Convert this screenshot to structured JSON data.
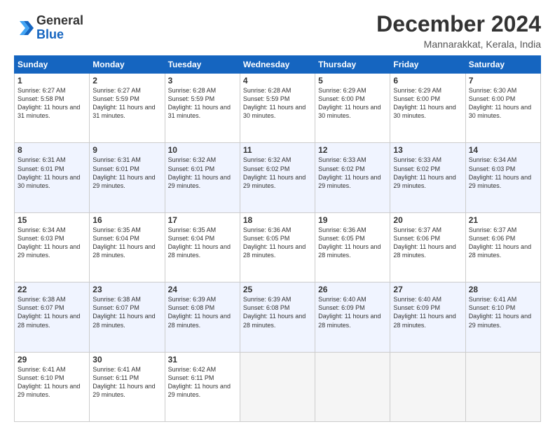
{
  "header": {
    "logo_line1": "General",
    "logo_line2": "Blue",
    "month": "December 2024",
    "location": "Mannarakkat, Kerala, India"
  },
  "days_of_week": [
    "Sunday",
    "Monday",
    "Tuesday",
    "Wednesday",
    "Thursday",
    "Friday",
    "Saturday"
  ],
  "weeks": [
    {
      "days": [
        {
          "num": "1",
          "rise": "6:27 AM",
          "set": "5:58 PM",
          "daylight": "11 hours and 31 minutes."
        },
        {
          "num": "2",
          "rise": "6:27 AM",
          "set": "5:59 PM",
          "daylight": "11 hours and 31 minutes."
        },
        {
          "num": "3",
          "rise": "6:28 AM",
          "set": "5:59 PM",
          "daylight": "11 hours and 31 minutes."
        },
        {
          "num": "4",
          "rise": "6:28 AM",
          "set": "5:59 PM",
          "daylight": "11 hours and 30 minutes."
        },
        {
          "num": "5",
          "rise": "6:29 AM",
          "set": "6:00 PM",
          "daylight": "11 hours and 30 minutes."
        },
        {
          "num": "6",
          "rise": "6:29 AM",
          "set": "6:00 PM",
          "daylight": "11 hours and 30 minutes."
        },
        {
          "num": "7",
          "rise": "6:30 AM",
          "set": "6:00 PM",
          "daylight": "11 hours and 30 minutes."
        }
      ]
    },
    {
      "days": [
        {
          "num": "8",
          "rise": "6:31 AM",
          "set": "6:01 PM",
          "daylight": "11 hours and 30 minutes."
        },
        {
          "num": "9",
          "rise": "6:31 AM",
          "set": "6:01 PM",
          "daylight": "11 hours and 29 minutes."
        },
        {
          "num": "10",
          "rise": "6:32 AM",
          "set": "6:01 PM",
          "daylight": "11 hours and 29 minutes."
        },
        {
          "num": "11",
          "rise": "6:32 AM",
          "set": "6:02 PM",
          "daylight": "11 hours and 29 minutes."
        },
        {
          "num": "12",
          "rise": "6:33 AM",
          "set": "6:02 PM",
          "daylight": "11 hours and 29 minutes."
        },
        {
          "num": "13",
          "rise": "6:33 AM",
          "set": "6:02 PM",
          "daylight": "11 hours and 29 minutes."
        },
        {
          "num": "14",
          "rise": "6:34 AM",
          "set": "6:03 PM",
          "daylight": "11 hours and 29 minutes."
        }
      ]
    },
    {
      "days": [
        {
          "num": "15",
          "rise": "6:34 AM",
          "set": "6:03 PM",
          "daylight": "11 hours and 29 minutes."
        },
        {
          "num": "16",
          "rise": "6:35 AM",
          "set": "6:04 PM",
          "daylight": "11 hours and 28 minutes."
        },
        {
          "num": "17",
          "rise": "6:35 AM",
          "set": "6:04 PM",
          "daylight": "11 hours and 28 minutes."
        },
        {
          "num": "18",
          "rise": "6:36 AM",
          "set": "6:05 PM",
          "daylight": "11 hours and 28 minutes."
        },
        {
          "num": "19",
          "rise": "6:36 AM",
          "set": "6:05 PM",
          "daylight": "11 hours and 28 minutes."
        },
        {
          "num": "20",
          "rise": "6:37 AM",
          "set": "6:06 PM",
          "daylight": "11 hours and 28 minutes."
        },
        {
          "num": "21",
          "rise": "6:37 AM",
          "set": "6:06 PM",
          "daylight": "11 hours and 28 minutes."
        }
      ]
    },
    {
      "days": [
        {
          "num": "22",
          "rise": "6:38 AM",
          "set": "6:07 PM",
          "daylight": "11 hours and 28 minutes."
        },
        {
          "num": "23",
          "rise": "6:38 AM",
          "set": "6:07 PM",
          "daylight": "11 hours and 28 minutes."
        },
        {
          "num": "24",
          "rise": "6:39 AM",
          "set": "6:08 PM",
          "daylight": "11 hours and 28 minutes."
        },
        {
          "num": "25",
          "rise": "6:39 AM",
          "set": "6:08 PM",
          "daylight": "11 hours and 28 minutes."
        },
        {
          "num": "26",
          "rise": "6:40 AM",
          "set": "6:09 PM",
          "daylight": "11 hours and 28 minutes."
        },
        {
          "num": "27",
          "rise": "6:40 AM",
          "set": "6:09 PM",
          "daylight": "11 hours and 28 minutes."
        },
        {
          "num": "28",
          "rise": "6:41 AM",
          "set": "6:10 PM",
          "daylight": "11 hours and 29 minutes."
        }
      ]
    },
    {
      "days": [
        {
          "num": "29",
          "rise": "6:41 AM",
          "set": "6:10 PM",
          "daylight": "11 hours and 29 minutes."
        },
        {
          "num": "30",
          "rise": "6:41 AM",
          "set": "6:11 PM",
          "daylight": "11 hours and 29 minutes."
        },
        {
          "num": "31",
          "rise": "6:42 AM",
          "set": "6:11 PM",
          "daylight": "11 hours and 29 minutes."
        },
        {
          "num": "",
          "rise": "",
          "set": "",
          "daylight": ""
        },
        {
          "num": "",
          "rise": "",
          "set": "",
          "daylight": ""
        },
        {
          "num": "",
          "rise": "",
          "set": "",
          "daylight": ""
        },
        {
          "num": "",
          "rise": "",
          "set": "",
          "daylight": ""
        }
      ]
    }
  ]
}
